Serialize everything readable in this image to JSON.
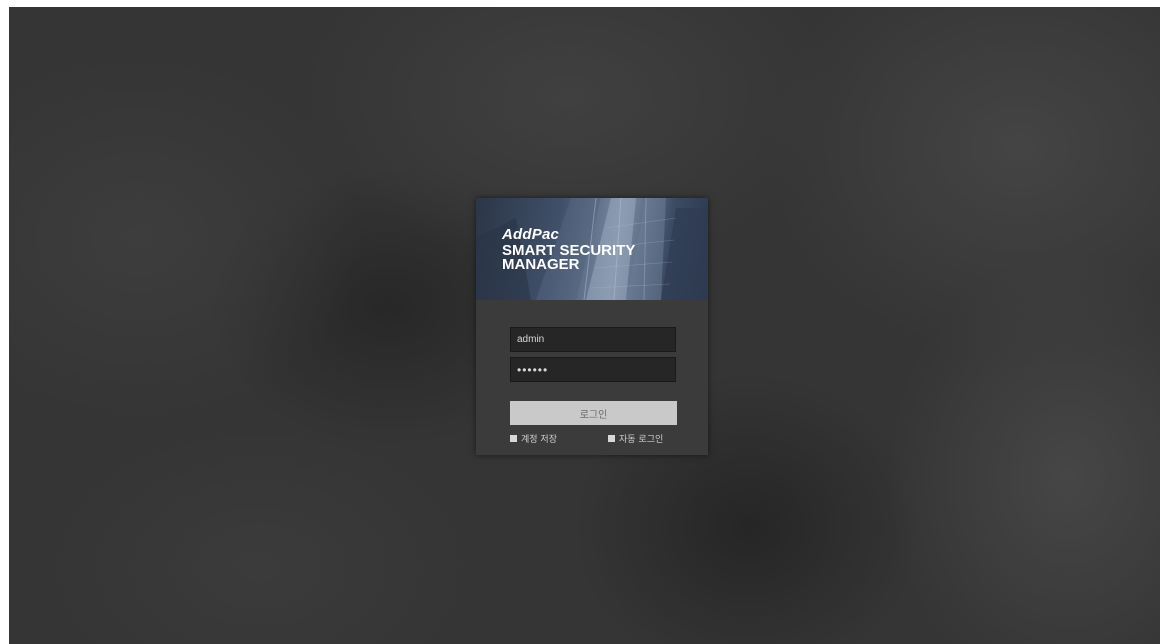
{
  "banner": {
    "brand": "AddPac",
    "product_line1": "SMART SECURITY",
    "product_line2": "MANAGER"
  },
  "form": {
    "username_value": "admin",
    "password_value": "••••••",
    "login_label": "로그인",
    "save_account_label": "계정 저장",
    "auto_login_label": "자동 로그인"
  },
  "colors": {
    "background": "#353535",
    "card": "#3b3b3b",
    "input_bg": "#262626",
    "button_bg": "#c9c9c9",
    "button_text": "#6b6b6b"
  }
}
